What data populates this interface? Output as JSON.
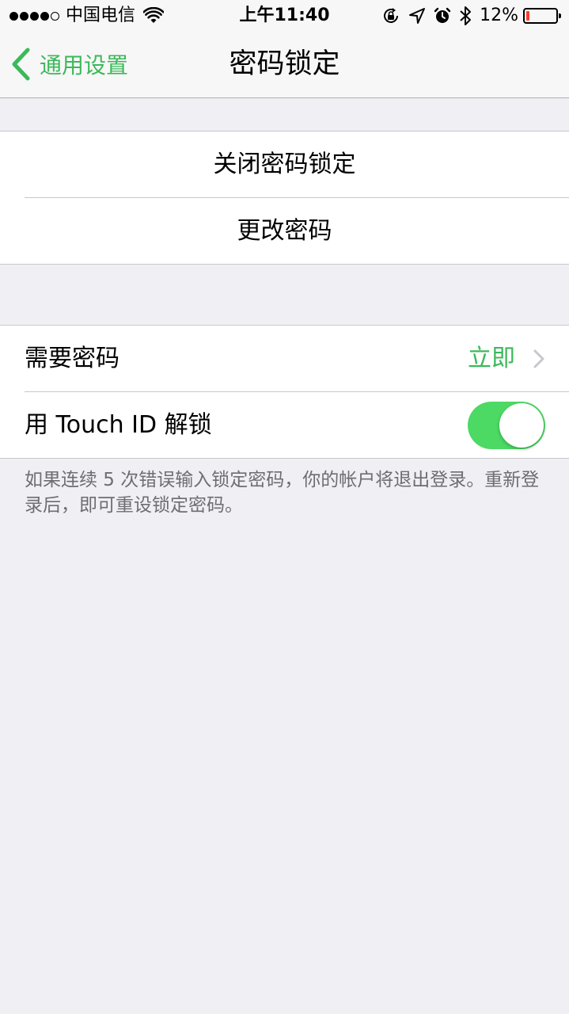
{
  "status_bar": {
    "signal_strength": "4/5",
    "carrier": "中国电信",
    "time": "上午11:40",
    "battery_percent": "12%",
    "battery_level": 0.12,
    "battery_color": "#ff3b30",
    "icons": [
      "wifi-icon",
      "orientation-lock-icon",
      "location-icon",
      "alarm-icon",
      "bluetooth-icon",
      "battery-icon"
    ]
  },
  "nav": {
    "back_label": "通用设置",
    "title": "密码锁定",
    "accent_color": "#3cb95a"
  },
  "group1": {
    "turn_off_label": "关闭密码锁定",
    "change_label": "更改密码"
  },
  "group2": {
    "require_label": "需要密码",
    "require_value": "立即",
    "touch_id_label": "用 Touch ID 解锁",
    "touch_id_enabled": true,
    "toggle_color": "#4cd964"
  },
  "footer_note": "如果连续 5 次错误输入锁定密码，你的帐户将退出登录。重新登录后，即可重设锁定密码。"
}
